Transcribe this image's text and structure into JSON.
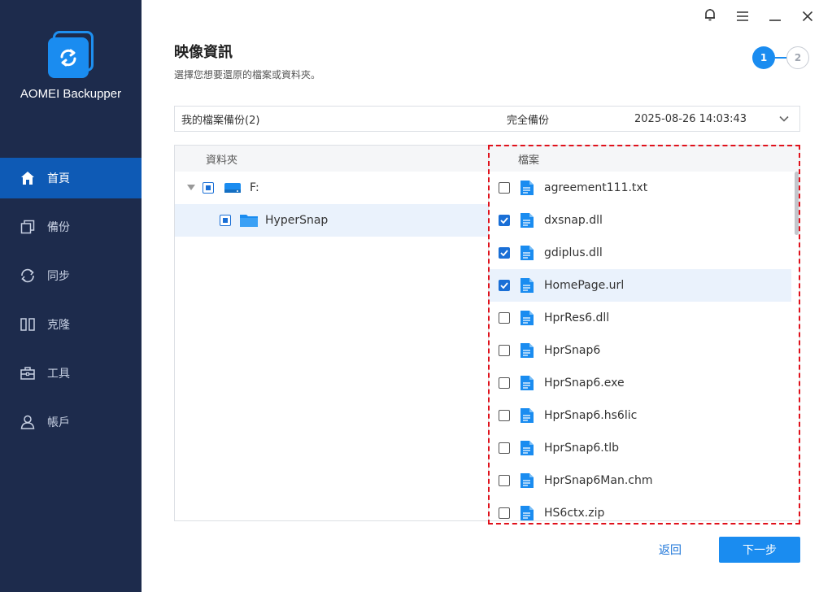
{
  "app": {
    "name": "AOMEI Backupper",
    "accent_color": "#1a8cf0",
    "sidebar_bg": "#1d2b4c"
  },
  "window_controls": [
    {
      "name": "bell-icon"
    },
    {
      "name": "menu-icon"
    },
    {
      "name": "minimize-icon"
    },
    {
      "name": "close-icon"
    }
  ],
  "sidebar": {
    "items": [
      {
        "label": "首頁",
        "icon": "home-icon",
        "active": true
      },
      {
        "label": "備份",
        "icon": "backup-icon",
        "active": false
      },
      {
        "label": "同步",
        "icon": "sync-icon",
        "active": false
      },
      {
        "label": "克隆",
        "icon": "clone-icon",
        "active": false
      },
      {
        "label": "工具",
        "icon": "toolbox-icon",
        "active": false
      },
      {
        "label": "帳戶",
        "icon": "user-icon",
        "active": false
      }
    ]
  },
  "header": {
    "title": "映像資訊",
    "subtitle": "選擇您想要還原的檔案或資料夾。",
    "steps": [
      "1",
      "2"
    ],
    "current_step": 1
  },
  "backup_select": {
    "name": "我的檔案備份(2)",
    "type": "完全備份",
    "time": "2025-08-26 14:03:43"
  },
  "folder_panel": {
    "header": "資料夾",
    "tree": [
      {
        "label": "F:",
        "level": 0,
        "expanded": true,
        "check": "partial",
        "icon": "drive-icon"
      },
      {
        "label": "HyperSnap",
        "level": 1,
        "check": "partial",
        "icon": "folder-icon",
        "selected": true
      }
    ]
  },
  "file_panel": {
    "header": "檔案",
    "files": [
      {
        "name": "agreement111.txt",
        "checked": false,
        "selected": false
      },
      {
        "name": "dxsnap.dll",
        "checked": true,
        "selected": false
      },
      {
        "name": "gdiplus.dll",
        "checked": true,
        "selected": false
      },
      {
        "name": "HomePage.url",
        "checked": true,
        "selected": true
      },
      {
        "name": "HprRes6.dll",
        "checked": false,
        "selected": false
      },
      {
        "name": "HprSnap6",
        "checked": false,
        "selected": false
      },
      {
        "name": "HprSnap6.exe",
        "checked": false,
        "selected": false
      },
      {
        "name": "HprSnap6.hs6lic",
        "checked": false,
        "selected": false
      },
      {
        "name": "HprSnap6.tlb",
        "checked": false,
        "selected": false
      },
      {
        "name": "HprSnap6Man.chm",
        "checked": false,
        "selected": false
      },
      {
        "name": "HS6ctx.zip",
        "checked": false,
        "selected": false
      }
    ]
  },
  "footer": {
    "back_label": "返回",
    "next_label": "下一步"
  }
}
